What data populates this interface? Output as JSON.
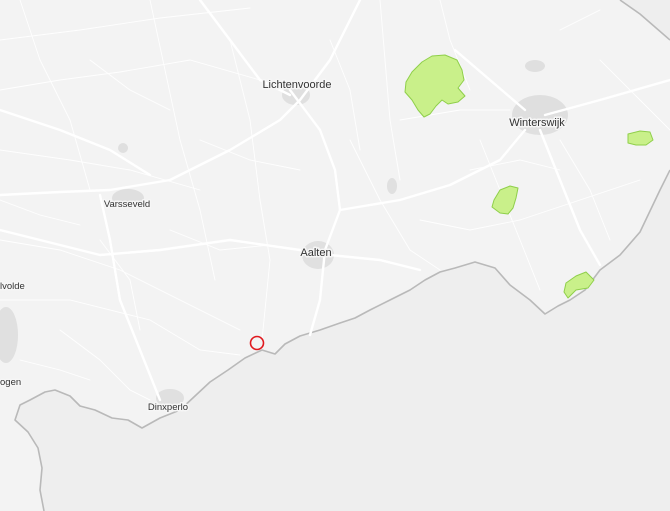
{
  "map": {
    "place_labels": {
      "lichtenvoorde": "Lichtenvoorde",
      "winterswijk": "Winterswijk",
      "varsseveld": "Varsseveld",
      "aalten": "Aalten",
      "dinxperlo": "Dinxperlo",
      "edge_upper": "lvolde",
      "edge_lower": "ogen"
    },
    "colors": {
      "background": "#eeeeee",
      "land": "#f3f3f3",
      "road": "#ffffff",
      "border": "#b9b9b9",
      "urban": "#dcdcdc",
      "nature_fill": "#c9f08a",
      "nature_stroke": "#8fcf4a",
      "marker": "#e0191e",
      "label": "#333333"
    },
    "marker": {
      "type": "circle-outline",
      "color": "#e0191e"
    }
  }
}
